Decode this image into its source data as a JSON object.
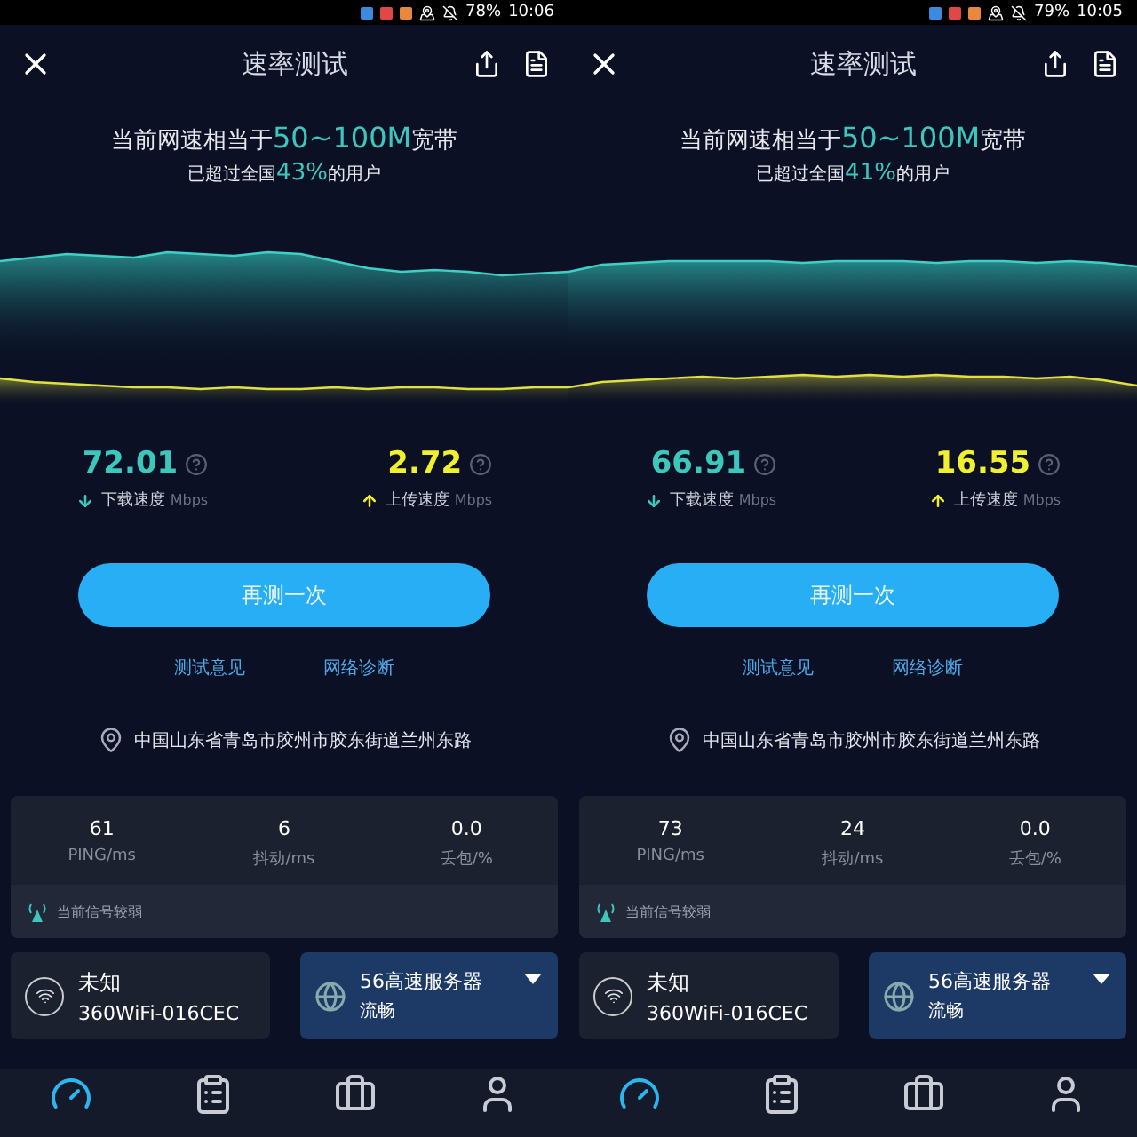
{
  "screens": [
    {
      "status": {
        "battery": "78%",
        "time": "10:06"
      },
      "title": "速率测试",
      "headline": {
        "prefix": "当前网速相当于",
        "range": "50~100M",
        "suffix": "宽带"
      },
      "ranking": {
        "prefix": "已超过全国",
        "percent": "43%",
        "suffix": "的用户"
      },
      "download": {
        "value": "72.01",
        "label": "下载速度",
        "unit": "Mbps"
      },
      "upload": {
        "value": "2.72",
        "label": "上传速度",
        "unit": "Mbps"
      },
      "retest": "再测一次",
      "links": [
        "测试意见",
        "网络诊断"
      ],
      "location": "中国山东省青岛市胶州市胶东街道兰州东路",
      "stats": [
        {
          "value": "61",
          "label": "PING/ms"
        },
        {
          "value": "6",
          "label": "抖动/ms"
        },
        {
          "value": "0.0",
          "label": "丢包/%"
        }
      ],
      "signal_note": "当前信号较弱",
      "network": {
        "name": "未知",
        "ssid": "360WiFi-016CEC"
      },
      "server": {
        "name": "56高速服务器",
        "status": "流畅"
      },
      "nav": [
        {
          "kind": "speed",
          "selected": true
        },
        {
          "kind": "history",
          "selected": false
        },
        {
          "kind": "tools",
          "selected": false
        },
        {
          "kind": "profile",
          "selected": false
        }
      ]
    },
    {
      "status": {
        "battery": "79%",
        "time": "10:05"
      },
      "title": "速率测试",
      "headline": {
        "prefix": "当前网速相当于",
        "range": "50~100M",
        "suffix": "宽带"
      },
      "ranking": {
        "prefix": "已超过全国",
        "percent": "41%",
        "suffix": "的用户"
      },
      "download": {
        "value": "66.91",
        "label": "下载速度",
        "unit": "Mbps"
      },
      "upload": {
        "value": "16.55",
        "label": "上传速度",
        "unit": "Mbps"
      },
      "retest": "再测一次",
      "links": [
        "测试意见",
        "网络诊断"
      ],
      "location": "中国山东省青岛市胶州市胶东街道兰州东路",
      "stats": [
        {
          "value": "73",
          "label": "PING/ms"
        },
        {
          "value": "24",
          "label": "抖动/ms"
        },
        {
          "value": "0.0",
          "label": "丢包/%"
        }
      ],
      "signal_note": "当前信号较弱",
      "network": {
        "name": "未知",
        "ssid": "360WiFi-016CEC"
      },
      "server": {
        "name": "56高速服务器",
        "status": "流畅"
      },
      "nav": [
        {
          "kind": "speed",
          "selected": true
        },
        {
          "kind": "history",
          "selected": false
        },
        {
          "kind": "tools",
          "selected": false
        },
        {
          "kind": "profile",
          "selected": false
        }
      ]
    }
  ]
}
